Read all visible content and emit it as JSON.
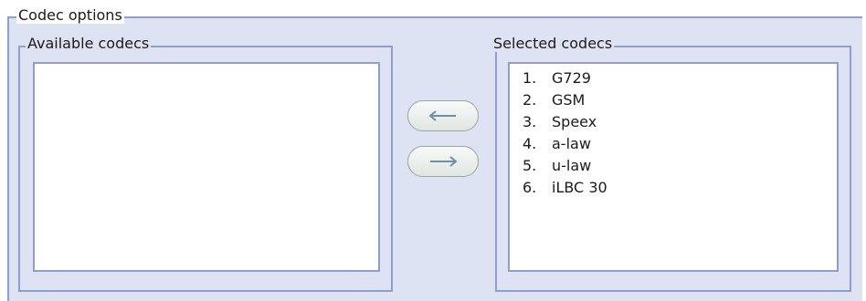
{
  "codec_options": {
    "title": "Codec options",
    "available": {
      "title": "Available codecs",
      "items": []
    },
    "selected": {
      "title": "Selected codecs",
      "items": [
        {
          "num": "1.",
          "name": "G729"
        },
        {
          "num": "2.",
          "name": "GSM"
        },
        {
          "num": "3.",
          "name": "Speex"
        },
        {
          "num": "4.",
          "name": "a-law"
        },
        {
          "num": "5.",
          "name": "u-law"
        },
        {
          "num": "6.",
          "name": "iLBC 30"
        }
      ]
    },
    "buttons": {
      "move_left_icon": "arrow-left-icon",
      "move_right_icon": "arrow-right-icon"
    },
    "colors": {
      "border": "#8c9fd0",
      "panel": "#dde3f2",
      "arrow": "#6f8fa2"
    }
  }
}
